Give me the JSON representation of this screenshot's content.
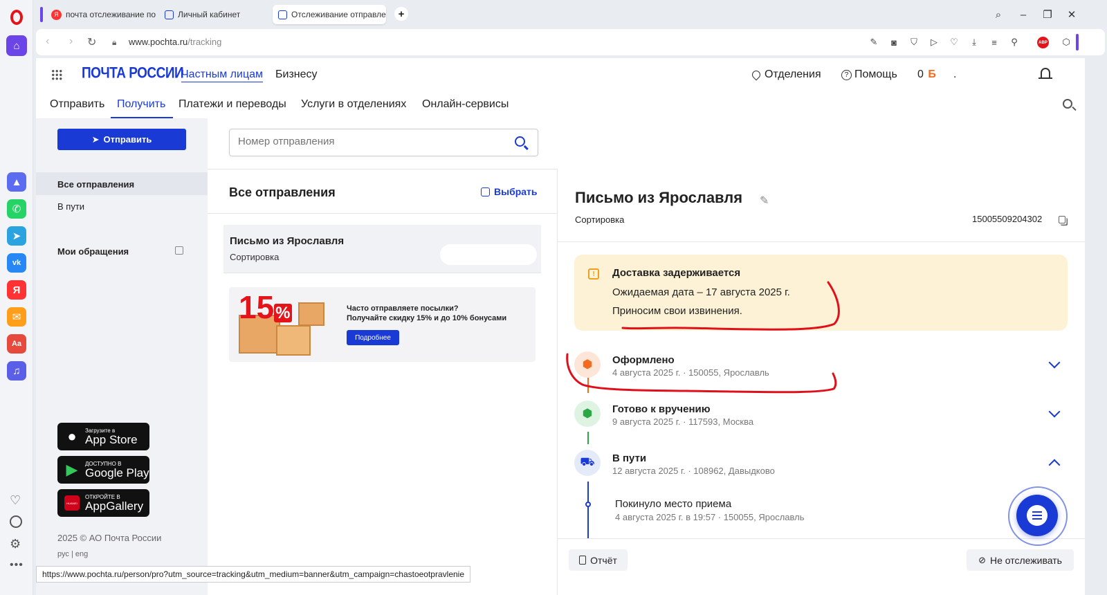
{
  "browser": {
    "tabs": [
      {
        "label": "почта отслеживание по т"
      },
      {
        "label": "Личный кабинет"
      },
      {
        "label": "Отслеживание отправле"
      }
    ],
    "new_tab": "+",
    "url_host": "www.pochta.ru",
    "url_path": "/tracking",
    "status_url": "https://www.pochta.ru/person/pro?utm_source=tracking&utm_medium=banner&utm_campaign=chastoeotpravlenie",
    "abp_label": "ABP"
  },
  "header": {
    "logo": "ПОЧТА РОССИИ",
    "nav_private": "Частным лицам",
    "nav_business": "Бизнесу",
    "offices": "Отделения",
    "help": "Помощь",
    "balance": "0",
    "currency_icon": "Б",
    "user_dot": "."
  },
  "subnav": [
    "Отправить",
    "Получить",
    "Платежи и переводы",
    "Услуги в отделениях",
    "Онлайн-сервисы"
  ],
  "sidebar": {
    "send_button": "Отправить",
    "items": [
      {
        "label": "Все отправления"
      },
      {
        "label": "В пути"
      }
    ],
    "appeals": "Мои обращения",
    "stores": [
      {
        "top": "Загрузите в",
        "name": "App Store"
      },
      {
        "top": "ДОСТУПНО В",
        "name": "Google Play"
      },
      {
        "top": "ОТКРОЙТЕ В",
        "name": "AppGallery"
      }
    ],
    "huawei_label": "HUAWEI",
    "copyright": "2025 © АО Почта России",
    "lang_ru": "рус",
    "lang_sep": "|",
    "lang_en": "eng"
  },
  "middle": {
    "search_placeholder": "Номер отправления",
    "title": "Все отправления",
    "select_label": "Выбрать",
    "item": {
      "title": "Письмо из Ярославля",
      "status": "Сортировка"
    },
    "banner": {
      "text1": "Часто отправляете посылки?",
      "text2": "Получайте скидку 15% и до 10% бонусами",
      "button": "Подробнее",
      "big": "15",
      "pct": "%"
    }
  },
  "detail": {
    "title": "Письмо из Ярославля",
    "status": "Сортировка",
    "track": "15005509204302",
    "alert": {
      "title": "Доставка задерживается",
      "line1": "Ожидаемая дата – 17 августа 2025 г.",
      "line2": "Приносим свои извинения."
    },
    "events": [
      {
        "title": "Оформлено",
        "sub": "4 августа 2025 г. · 150055, Ярославль"
      },
      {
        "title": "Готово к вручению",
        "sub": "9 августа 2025 г. · 117593, Москва"
      },
      {
        "title": "В пути",
        "sub": "12 августа 2025 г. · 108962, Давыдково"
      }
    ],
    "subevent": {
      "title": "Покинуло место приема",
      "sub": "4 августа 2025 г. в 19:57 · 150055, Ярославль"
    },
    "report_button": "Отчёт",
    "untrack_button": "Не отслеживать"
  },
  "colors": {
    "brand_blue": "#1a3ad6",
    "alert_bg": "#fdf2d6",
    "orange": "#f46a1f",
    "green": "#2aa845",
    "annotation_red": "#e0101a"
  }
}
